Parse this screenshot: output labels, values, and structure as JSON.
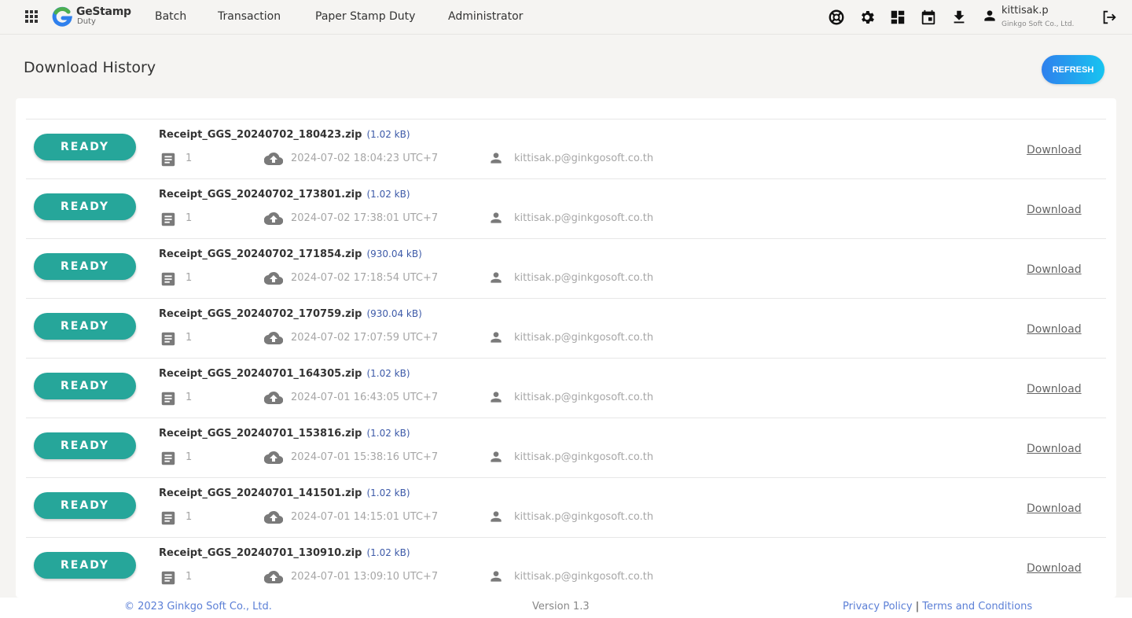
{
  "app": {
    "logo_title": "GeStamp",
    "logo_subtitle": "Duty",
    "brand_colors": {
      "logo_green": "#4caf50",
      "logo_blue": "#2f80ed",
      "status_teal": "#26a69a",
      "link_blue": "#5b7fd6"
    }
  },
  "nav": {
    "items": [
      {
        "label": "Batch"
      },
      {
        "label": "Transaction"
      },
      {
        "label": "Paper Stamp Duty"
      },
      {
        "label": "Administrator"
      }
    ]
  },
  "toolbar": {
    "icons": [
      "help-lifebuoy-icon",
      "settings-gear-icon",
      "dashboard-icon",
      "calendar-icon",
      "download-icon"
    ]
  },
  "user": {
    "name": "kittisak.p",
    "org": "Ginkgo Soft Co., Ltd."
  },
  "page": {
    "title": "Download History",
    "refresh_label": "REFRESH"
  },
  "downloads": [
    {
      "status": "READY",
      "filename": "Receipt_GGS_20240702_180423.zip",
      "size": "(1.02 kB)",
      "count": "1",
      "timestamp": "2024-07-02 18:04:23 UTC+7",
      "user": "kittisak.p@ginkgosoft.co.th",
      "action": "Download"
    },
    {
      "status": "READY",
      "filename": "Receipt_GGS_20240702_173801.zip",
      "size": "(1.02 kB)",
      "count": "1",
      "timestamp": "2024-07-02 17:38:01 UTC+7",
      "user": "kittisak.p@ginkgosoft.co.th",
      "action": "Download"
    },
    {
      "status": "READY",
      "filename": "Receipt_GGS_20240702_171854.zip",
      "size": "(930.04 kB)",
      "count": "1",
      "timestamp": "2024-07-02 17:18:54 UTC+7",
      "user": "kittisak.p@ginkgosoft.co.th",
      "action": "Download"
    },
    {
      "status": "READY",
      "filename": "Receipt_GGS_20240702_170759.zip",
      "size": "(930.04 kB)",
      "count": "1",
      "timestamp": "2024-07-02 17:07:59 UTC+7",
      "user": "kittisak.p@ginkgosoft.co.th",
      "action": "Download"
    },
    {
      "status": "READY",
      "filename": "Receipt_GGS_20240701_164305.zip",
      "size": "(1.02 kB)",
      "count": "1",
      "timestamp": "2024-07-01 16:43:05 UTC+7",
      "user": "kittisak.p@ginkgosoft.co.th",
      "action": "Download"
    },
    {
      "status": "READY",
      "filename": "Receipt_GGS_20240701_153816.zip",
      "size": "(1.02 kB)",
      "count": "1",
      "timestamp": "2024-07-01 15:38:16 UTC+7",
      "user": "kittisak.p@ginkgosoft.co.th",
      "action": "Download"
    },
    {
      "status": "READY",
      "filename": "Receipt_GGS_20240701_141501.zip",
      "size": "(1.02 kB)",
      "count": "1",
      "timestamp": "2024-07-01 14:15:01 UTC+7",
      "user": "kittisak.p@ginkgosoft.co.th",
      "action": "Download"
    },
    {
      "status": "READY",
      "filename": "Receipt_GGS_20240701_130910.zip",
      "size": "(1.02 kB)",
      "count": "1",
      "timestamp": "2024-07-01 13:09:10 UTC+7",
      "user": "kittisak.p@ginkgosoft.co.th",
      "action": "Download"
    }
  ],
  "footer": {
    "copyright": "© 2023 Ginkgo Soft Co., Ltd.",
    "version": "Version 1.3",
    "privacy": "Privacy Policy",
    "separator": "|",
    "terms": "Terms and Conditions"
  }
}
